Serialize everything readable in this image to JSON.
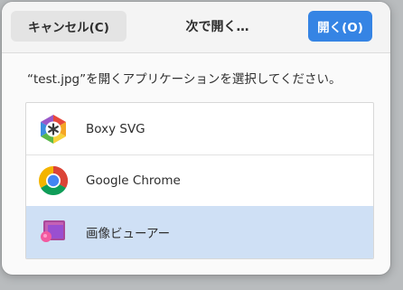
{
  "header": {
    "cancel_label": "キャンセル(C)",
    "title": "次で開く…",
    "open_label": "開く(O)"
  },
  "prompt": "“test.jpg”を開くアプリケーションを選択してください。",
  "apps": [
    {
      "name": "Boxy SVG",
      "icon": "boxy-svg-icon",
      "selected": false
    },
    {
      "name": "Google Chrome",
      "icon": "chrome-icon",
      "selected": false
    },
    {
      "name": "画像ビューアー",
      "icon": "image-viewer-icon",
      "selected": true
    }
  ],
  "colors": {
    "accent": "#3584e4",
    "selected_row": "#cfe0f5"
  }
}
